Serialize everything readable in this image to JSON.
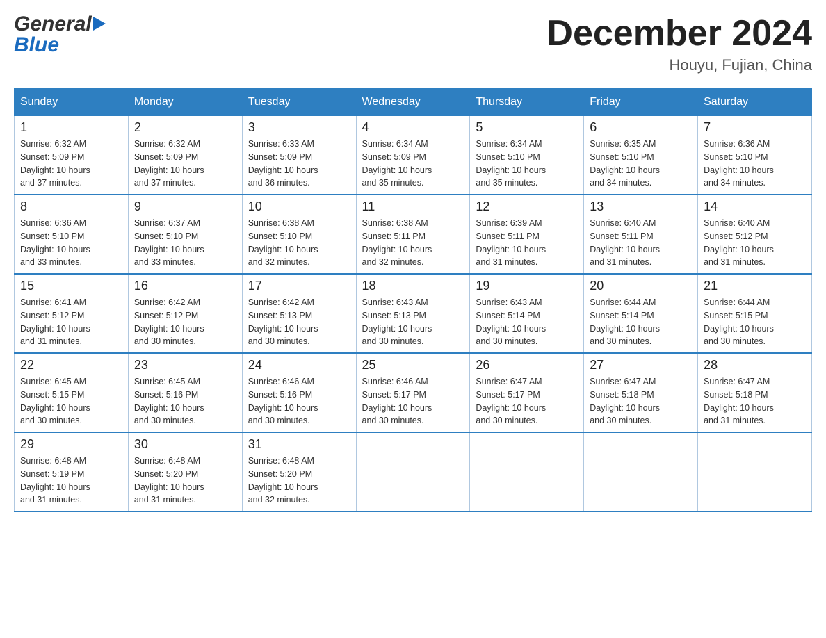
{
  "logo": {
    "line1": "General",
    "line2": "Blue"
  },
  "title": {
    "month_year": "December 2024",
    "location": "Houyu, Fujian, China"
  },
  "weekdays": [
    "Sunday",
    "Monday",
    "Tuesday",
    "Wednesday",
    "Thursday",
    "Friday",
    "Saturday"
  ],
  "weeks": [
    [
      {
        "day": "1",
        "sunrise": "6:32 AM",
        "sunset": "5:09 PM",
        "daylight": "10 hours and 37 minutes."
      },
      {
        "day": "2",
        "sunrise": "6:32 AM",
        "sunset": "5:09 PM",
        "daylight": "10 hours and 37 minutes."
      },
      {
        "day": "3",
        "sunrise": "6:33 AM",
        "sunset": "5:09 PM",
        "daylight": "10 hours and 36 minutes."
      },
      {
        "day": "4",
        "sunrise": "6:34 AM",
        "sunset": "5:09 PM",
        "daylight": "10 hours and 35 minutes."
      },
      {
        "day": "5",
        "sunrise": "6:34 AM",
        "sunset": "5:10 PM",
        "daylight": "10 hours and 35 minutes."
      },
      {
        "day": "6",
        "sunrise": "6:35 AM",
        "sunset": "5:10 PM",
        "daylight": "10 hours and 34 minutes."
      },
      {
        "day": "7",
        "sunrise": "6:36 AM",
        "sunset": "5:10 PM",
        "daylight": "10 hours and 34 minutes."
      }
    ],
    [
      {
        "day": "8",
        "sunrise": "6:36 AM",
        "sunset": "5:10 PM",
        "daylight": "10 hours and 33 minutes."
      },
      {
        "day": "9",
        "sunrise": "6:37 AM",
        "sunset": "5:10 PM",
        "daylight": "10 hours and 33 minutes."
      },
      {
        "day": "10",
        "sunrise": "6:38 AM",
        "sunset": "5:10 PM",
        "daylight": "10 hours and 32 minutes."
      },
      {
        "day": "11",
        "sunrise": "6:38 AM",
        "sunset": "5:11 PM",
        "daylight": "10 hours and 32 minutes."
      },
      {
        "day": "12",
        "sunrise": "6:39 AM",
        "sunset": "5:11 PM",
        "daylight": "10 hours and 31 minutes."
      },
      {
        "day": "13",
        "sunrise": "6:40 AM",
        "sunset": "5:11 PM",
        "daylight": "10 hours and 31 minutes."
      },
      {
        "day": "14",
        "sunrise": "6:40 AM",
        "sunset": "5:12 PM",
        "daylight": "10 hours and 31 minutes."
      }
    ],
    [
      {
        "day": "15",
        "sunrise": "6:41 AM",
        "sunset": "5:12 PM",
        "daylight": "10 hours and 31 minutes."
      },
      {
        "day": "16",
        "sunrise": "6:42 AM",
        "sunset": "5:12 PM",
        "daylight": "10 hours and 30 minutes."
      },
      {
        "day": "17",
        "sunrise": "6:42 AM",
        "sunset": "5:13 PM",
        "daylight": "10 hours and 30 minutes."
      },
      {
        "day": "18",
        "sunrise": "6:43 AM",
        "sunset": "5:13 PM",
        "daylight": "10 hours and 30 minutes."
      },
      {
        "day": "19",
        "sunrise": "6:43 AM",
        "sunset": "5:14 PM",
        "daylight": "10 hours and 30 minutes."
      },
      {
        "day": "20",
        "sunrise": "6:44 AM",
        "sunset": "5:14 PM",
        "daylight": "10 hours and 30 minutes."
      },
      {
        "day": "21",
        "sunrise": "6:44 AM",
        "sunset": "5:15 PM",
        "daylight": "10 hours and 30 minutes."
      }
    ],
    [
      {
        "day": "22",
        "sunrise": "6:45 AM",
        "sunset": "5:15 PM",
        "daylight": "10 hours and 30 minutes."
      },
      {
        "day": "23",
        "sunrise": "6:45 AM",
        "sunset": "5:16 PM",
        "daylight": "10 hours and 30 minutes."
      },
      {
        "day": "24",
        "sunrise": "6:46 AM",
        "sunset": "5:16 PM",
        "daylight": "10 hours and 30 minutes."
      },
      {
        "day": "25",
        "sunrise": "6:46 AM",
        "sunset": "5:17 PM",
        "daylight": "10 hours and 30 minutes."
      },
      {
        "day": "26",
        "sunrise": "6:47 AM",
        "sunset": "5:17 PM",
        "daylight": "10 hours and 30 minutes."
      },
      {
        "day": "27",
        "sunrise": "6:47 AM",
        "sunset": "5:18 PM",
        "daylight": "10 hours and 30 minutes."
      },
      {
        "day": "28",
        "sunrise": "6:47 AM",
        "sunset": "5:18 PM",
        "daylight": "10 hours and 31 minutes."
      }
    ],
    [
      {
        "day": "29",
        "sunrise": "6:48 AM",
        "sunset": "5:19 PM",
        "daylight": "10 hours and 31 minutes."
      },
      {
        "day": "30",
        "sunrise": "6:48 AM",
        "sunset": "5:20 PM",
        "daylight": "10 hours and 31 minutes."
      },
      {
        "day": "31",
        "sunrise": "6:48 AM",
        "sunset": "5:20 PM",
        "daylight": "10 hours and 32 minutes."
      },
      null,
      null,
      null,
      null
    ]
  ],
  "labels": {
    "sunrise": "Sunrise:",
    "sunset": "Sunset:",
    "daylight": "Daylight:"
  }
}
